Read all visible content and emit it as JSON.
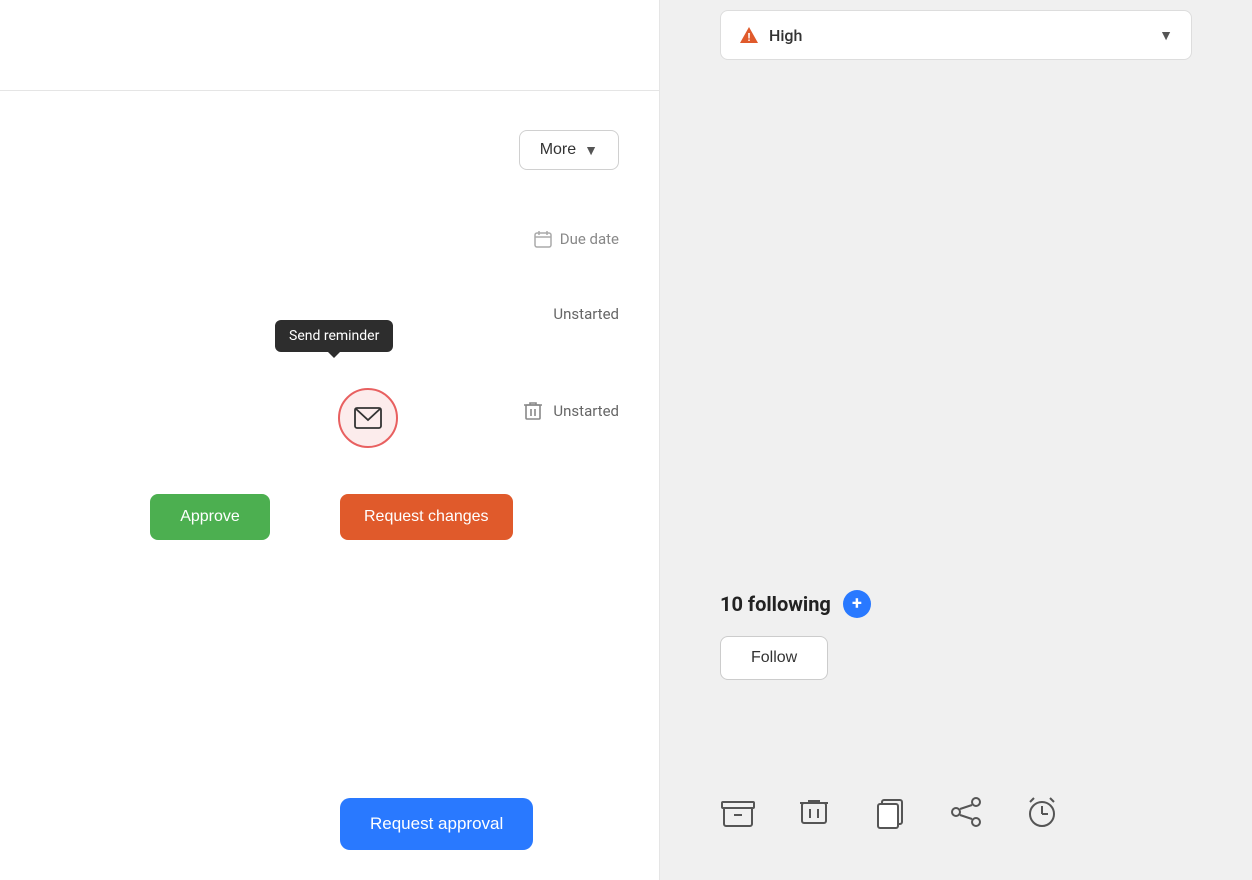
{
  "left": {
    "more_button_label": "More",
    "due_date_label": "Due date",
    "unstarted_label_1": "Unstarted",
    "unstarted_label_2": "Unstarted",
    "tooltip_label": "Send reminder",
    "approve_label": "Approve",
    "request_changes_label": "Request changes",
    "request_approval_label": "Request approval"
  },
  "right": {
    "priority_label": "High",
    "following_count_label": "10 following",
    "follow_button_label": "Follow",
    "add_icon": "+",
    "priority_icon": "warning"
  },
  "icons": {
    "archive": "archive-icon",
    "trash": "trash-icon",
    "copy": "copy-icon",
    "share": "share-icon",
    "alarm": "alarm-icon"
  }
}
